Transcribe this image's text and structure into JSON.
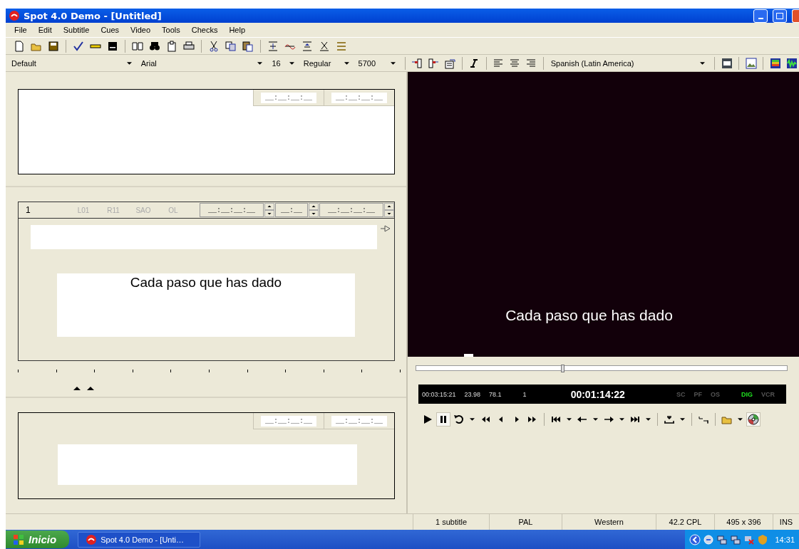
{
  "window": {
    "title": "Spot 4.0 Demo - [Untitled]"
  },
  "menu": [
    "File",
    "Edit",
    "Subtitle",
    "Cues",
    "Video",
    "Tools",
    "Checks",
    "Help"
  ],
  "format_bar": {
    "style": "Default",
    "font": "Arial",
    "size": "16",
    "weight": "Regular",
    "value": "5700",
    "language": "Spanish (Latin America)"
  },
  "previous_subtitle": {
    "timecodes": [
      "__:__:__:__",
      "__:__:__:__"
    ]
  },
  "editor": {
    "number": "1",
    "flags": [
      "L01",
      "R11",
      "SAO",
      "OL"
    ],
    "timecodes": [
      "__:__:__:__",
      "__:__",
      "__:__:__:__"
    ],
    "text": "Cada paso que has dado"
  },
  "next_subtitle": {
    "timecodes": [
      "__:__:__:__",
      "__:__:__:__"
    ]
  },
  "video": {
    "subtitle": "Cada paso que has dado",
    "level": 0.39
  },
  "info_bar": {
    "duration": "00:03:15:21",
    "fps": "23.98",
    "value": "78.1",
    "count": "1",
    "timecode": "00:01:14:22",
    "indicators": [
      {
        "label": "SC",
        "on": false
      },
      {
        "label": "PF",
        "on": false
      },
      {
        "label": "OS",
        "on": false
      },
      {
        "label": "DIG",
        "on": true
      },
      {
        "label": "VCR",
        "on": false
      }
    ]
  },
  "transport": {
    "paused": true,
    "disc_mode": true
  },
  "status_bar": [
    "1 subtitle",
    "PAL",
    "Western",
    "42.2 CPL",
    "495 x 396",
    "INS"
  ],
  "taskbar": {
    "start": "Inicio",
    "task": "Spot 4.0 Demo - [Unti…",
    "clock": "14:31"
  }
}
